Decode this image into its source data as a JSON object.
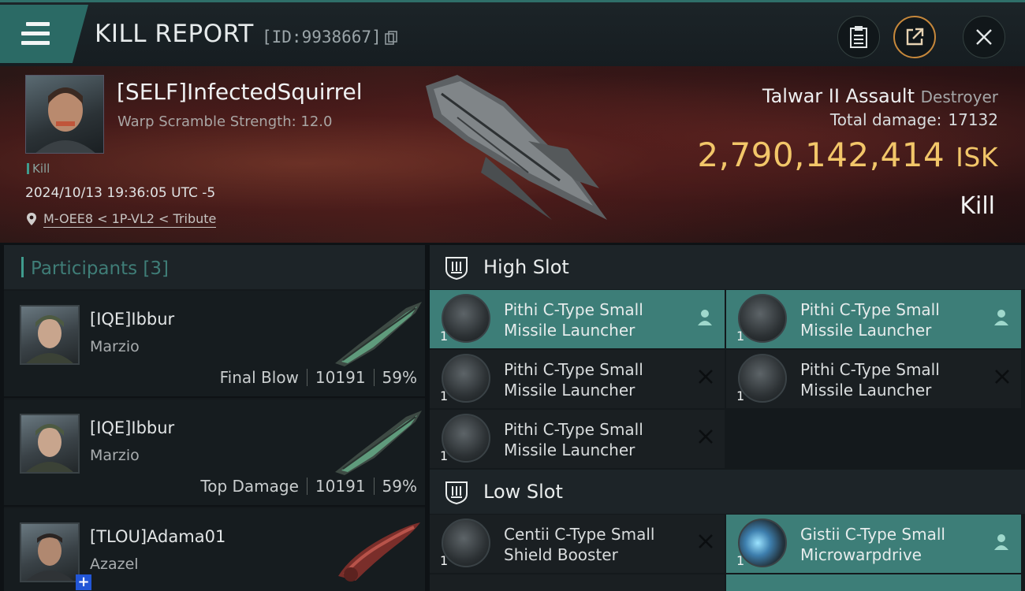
{
  "header": {
    "title": "KILL REPORT",
    "id_text": "[ID:9938667]"
  },
  "banner": {
    "pilot_name": "[SELF]InfectedSquirrel",
    "scramble": "Warp Scramble Strength: 12.0",
    "kill_tag": "Kill",
    "datetime": "2024/10/13 19:36:05 UTC -5",
    "location": "M-OEE8 < 1P-VL2 < Tribute",
    "ship_name": "Talwar II Assault",
    "ship_class": "Destroyer",
    "total_damage_label": "Total damage:",
    "total_damage": "17132",
    "isk_value": "2,790,142,414",
    "isk_unit": "ISK",
    "result": "Kill"
  },
  "participants": {
    "label": "Participants",
    "count": "[3]",
    "rows": [
      {
        "name": "[IQE]Ibbur",
        "corp": "Marzio",
        "role": "Final Blow",
        "damage": "10191",
        "percent": "59%"
      },
      {
        "name": "[IQE]Ibbur",
        "corp": "Marzio",
        "role": "Top Damage",
        "damage": "10191",
        "percent": "59%"
      },
      {
        "name": "[TLOU]Adama01",
        "corp": "Azazel"
      }
    ]
  },
  "slots": {
    "high_label": "High Slot",
    "low_label": "Low Slot",
    "high_items": [
      {
        "line1": "Pithi C-Type Small",
        "line2": "Missile Launcher",
        "qty": "1"
      },
      {
        "line1": "Pithi C-Type Small",
        "line2": "Missile Launcher",
        "qty": "1"
      },
      {
        "line1": "Pithi C-Type Small",
        "line2": "Missile Launcher",
        "qty": "1"
      },
      {
        "line1": "Pithi C-Type Small",
        "line2": "Missile Launcher",
        "qty": "1"
      },
      {
        "line1": "Pithi C-Type Small",
        "line2": "Missile Launcher",
        "qty": "1"
      }
    ],
    "low_items": [
      {
        "line1": "Centii C-Type Small",
        "line2": "Shield Booster",
        "qty": "1"
      },
      {
        "line1": "Gistii C-Type Small",
        "line2": "Microwarpdrive",
        "qty": "1"
      }
    ]
  },
  "colors": {
    "accent": "#3d7e78",
    "isk": "#f2c669",
    "share_ring": "#c7883b"
  }
}
